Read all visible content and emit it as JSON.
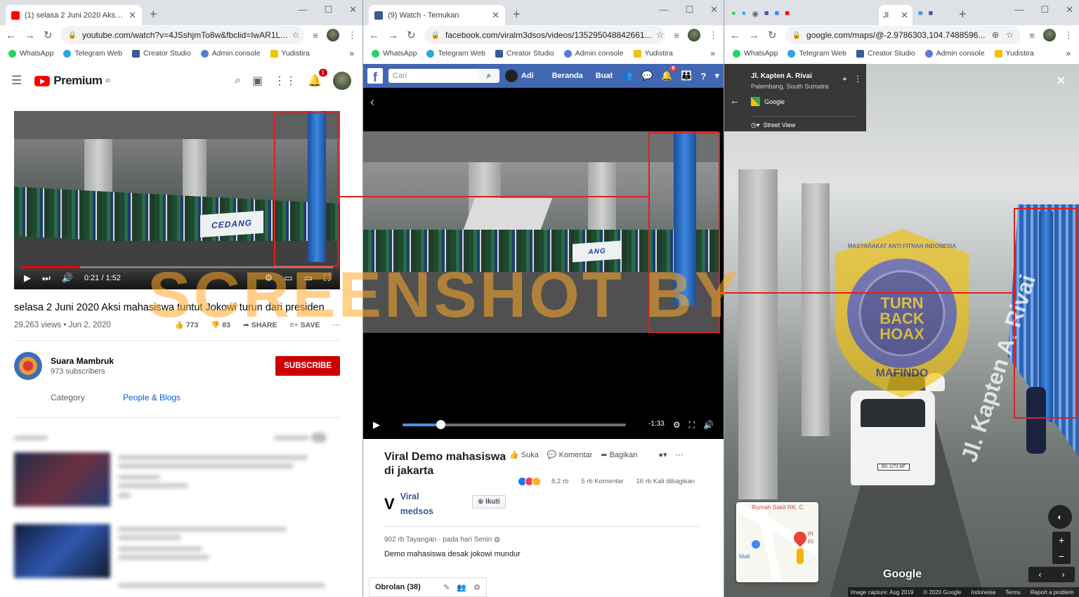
{
  "win1": {
    "tab_title": "(1) selasa 2 Juni 2020 Aksi mahas",
    "url": "youtube.com/watch?v=4JSshjmTo8w&fbclid=IwAR1L...",
    "bookmarks": [
      "WhatsApp",
      "Telegram Web",
      "Creator Studio",
      "Admin console",
      "Yudistira"
    ],
    "logo_text": "Premium",
    "logo_sup": "ID",
    "notif_count": "1",
    "banner_text": "CEDANG",
    "time": "0:21 / 1:52",
    "progress": 0.19,
    "title": "selasa 2 Juni 2020 Aksi mahasiswa tuntut Jokowi turun dari presiden",
    "views": "29,263 views • Jun 2, 2020",
    "likes": "773",
    "dislikes": "83",
    "share": "SHARE",
    "save": "SAVE",
    "channel": "Suara Mambruk",
    "subscribers": "973 subscribers",
    "subscribe": "SUBSCRIBE",
    "category_label": "Category",
    "category_value": "People & Blogs"
  },
  "win2": {
    "tab_title": "(9) Watch - Temukan",
    "url": "facebook.com/viralm3dsos/videos/135295048842661...",
    "bookmarks": [
      "WhatsApp",
      "Telegram Web",
      "Creator Studio",
      "Admin console",
      "Yudistira"
    ],
    "search_placeholder": "Cari",
    "profile": "Adi",
    "nav_home": "Beranda",
    "nav_create": "Buat",
    "notif_count": "9",
    "time_left": "-1:33",
    "progress": 0.17,
    "title": "Viral Demo mahasiswa di jakarta",
    "like": "Suka",
    "comment": "Komentar",
    "share": "Bagikan",
    "reactions": "8,2 rb",
    "comments": "5 rb Komentar",
    "shares": "16 rb Kali dibagikan",
    "page_name": "Viral medsos",
    "follow": "Ikuti",
    "views": "902 rb Tayangan",
    "posted": "pada hari Senin",
    "description": "Demo mahasiswa desak jokowi mundur",
    "chat": "Obrolan (38)"
  },
  "win3": {
    "tab_title": "Jl",
    "url": "google.com/maps/@-2.9786303,104.7488596...",
    "bookmarks": [
      "WhatsApp",
      "Telegram Web",
      "Creator Studio",
      "Admin console",
      "Yudistira"
    ],
    "place": "Jl. Kapten A. Rivai",
    "region": "Palembang, South Sumatra",
    "provider": "Google",
    "mode": "Street View",
    "minimap_text1": "Rumah Sakit RK. C",
    "minimap_text2": "Pl Ri",
    "minimap_text3": "Mall",
    "road_label": "Jl. Kapten A. Rivai",
    "plate": "BG 1273 MF",
    "google": "Google",
    "footer": [
      "Image capture: Aug 2019",
      "© 2020 Google",
      "Indonesia",
      "Terms",
      "Report a problem"
    ]
  },
  "watermark": "SCREENSHOT BY",
  "seal": {
    "ring_top": "MASYARAKAT ANTI FITNAH INDONESIA",
    "ring_bottom": "MAFINDO",
    "center": "TURN BACK HOAX"
  },
  "colors": {
    "youtube_red": "#ff0000",
    "facebook_blue": "#4267b2",
    "highlight_red": "#e02020",
    "watermark_orange": "#ffaa28"
  }
}
